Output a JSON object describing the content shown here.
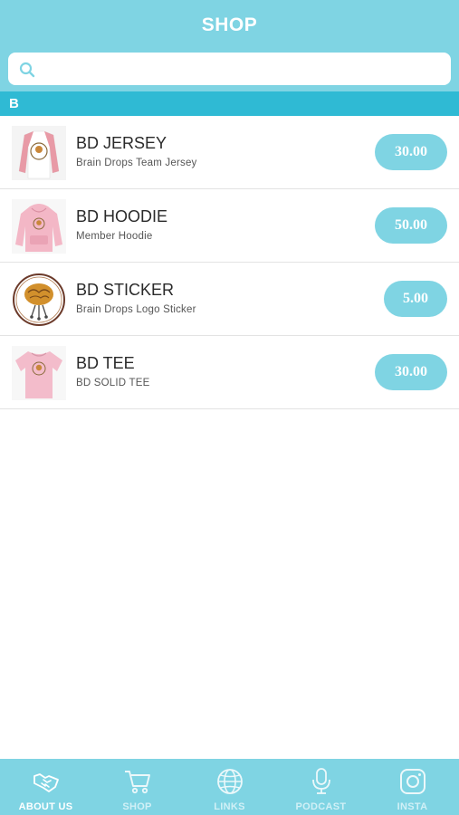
{
  "header": {
    "title": "SHOP"
  },
  "search": {
    "placeholder": "",
    "value": ""
  },
  "section": {
    "letter": "B"
  },
  "products": [
    {
      "name": "BD JERSEY",
      "description": "Brain Drops Team Jersey",
      "price": "30.00",
      "thumbnail_icon": "jersey-icon"
    },
    {
      "name": "BD HOODIE",
      "description": "Member Hoodie",
      "price": "50.00",
      "thumbnail_icon": "hoodie-icon"
    },
    {
      "name": "BD STICKER",
      "description": "Brain Drops Logo Sticker",
      "price": "5.00",
      "thumbnail_icon": "sticker-icon"
    },
    {
      "name": "BD TEE",
      "description": "BD SOLID TEE",
      "price": "30.00",
      "thumbnail_icon": "tee-icon"
    }
  ],
  "tabbar": {
    "tabs": [
      {
        "label": "ABOUT US",
        "icon": "handshake-icon",
        "active": true
      },
      {
        "label": "SHOP",
        "icon": "cart-icon",
        "active": false
      },
      {
        "label": "LINKS",
        "icon": "globe-icon",
        "active": false
      },
      {
        "label": "PODCAST",
        "icon": "microphone-icon",
        "active": false
      },
      {
        "label": "INSTA",
        "icon": "instagram-icon",
        "active": false
      }
    ]
  },
  "colors": {
    "header_bg": "#7fd4e3",
    "section_bar": "#2fbad4",
    "price_pill": "#7fd4e3",
    "tabbar_bg": "#7fd4e3"
  }
}
